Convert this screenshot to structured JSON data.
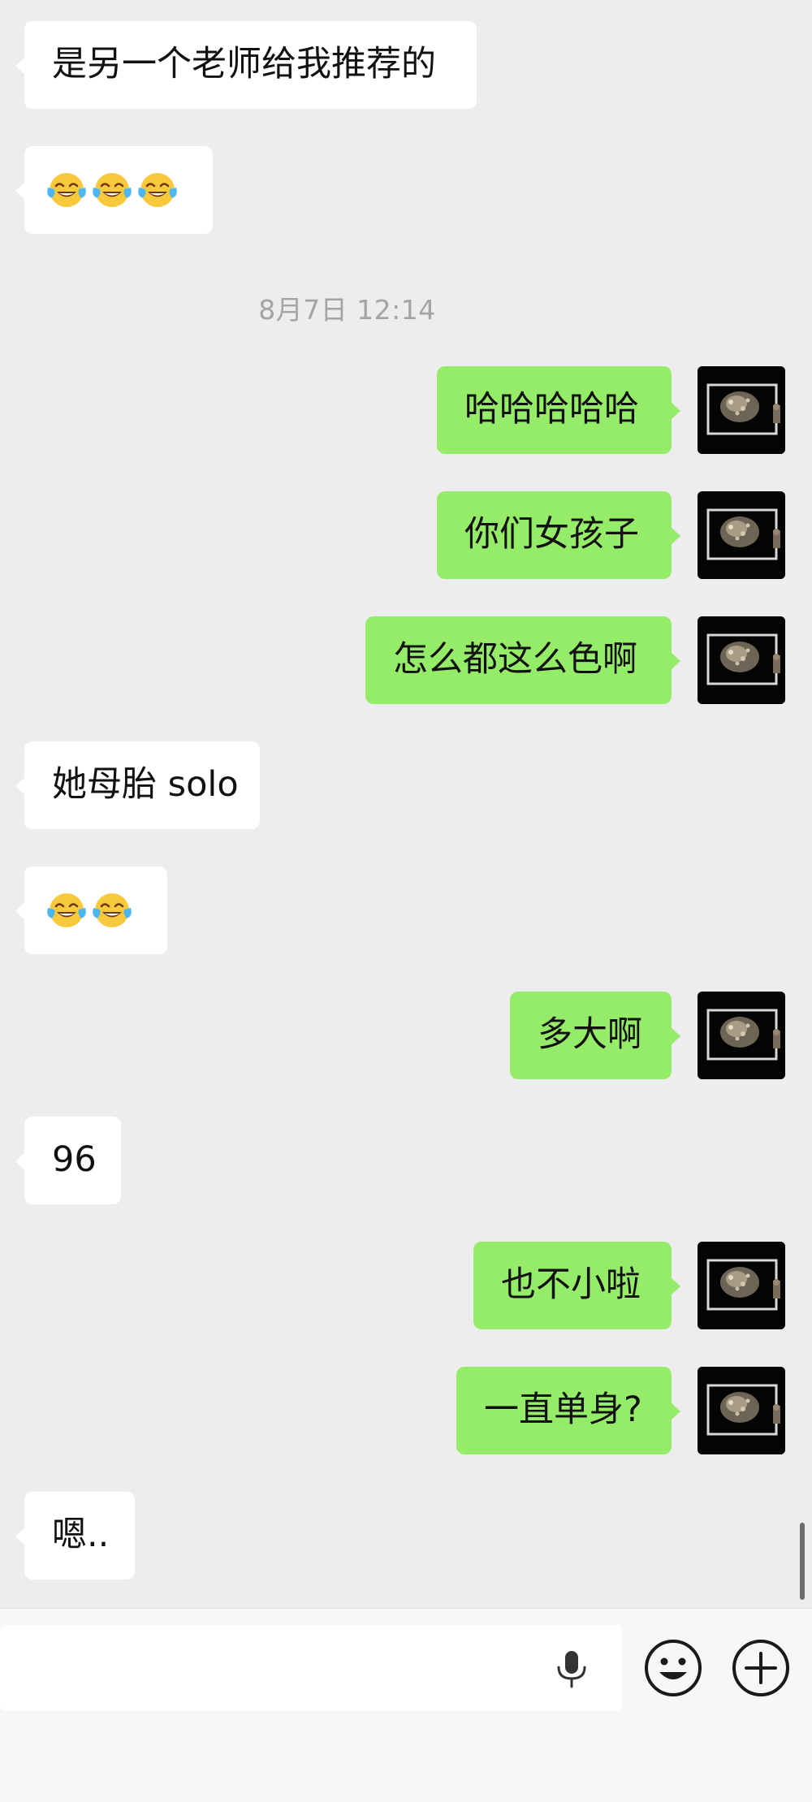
{
  "chat": {
    "timestamp": "8月7日 12:14",
    "messages": [
      {
        "side": "left",
        "text": "是另一个老师给我推荐的"
      },
      {
        "side": "left",
        "emoji": "tears-of-joy-emoji",
        "count": 3
      },
      {
        "side": "right",
        "text": "哈哈哈哈哈"
      },
      {
        "side": "right",
        "text": "你们女孩子"
      },
      {
        "side": "right",
        "text": "怎么都这么色啊"
      },
      {
        "side": "left",
        "text": "她母胎 solo"
      },
      {
        "side": "left",
        "emoji": "tears-of-joy-emoji",
        "count": 2
      },
      {
        "side": "right",
        "text": "多大啊"
      },
      {
        "side": "left",
        "text": "96"
      },
      {
        "side": "right",
        "text": "也不小啦"
      },
      {
        "side": "right",
        "text": "一直单身?"
      },
      {
        "side": "left",
        "text": "嗯.."
      }
    ]
  },
  "input_bar": {
    "voice_icon": "microphone-icon",
    "emoji_icon": "smiley-face-icon",
    "more_icon": "plus-circle-icon"
  },
  "colors": {
    "background": "#ededed",
    "outgoing_bubble": "#95ec69",
    "incoming_bubble": "#ffffff",
    "timestamp_text": "#a4a4a4"
  }
}
